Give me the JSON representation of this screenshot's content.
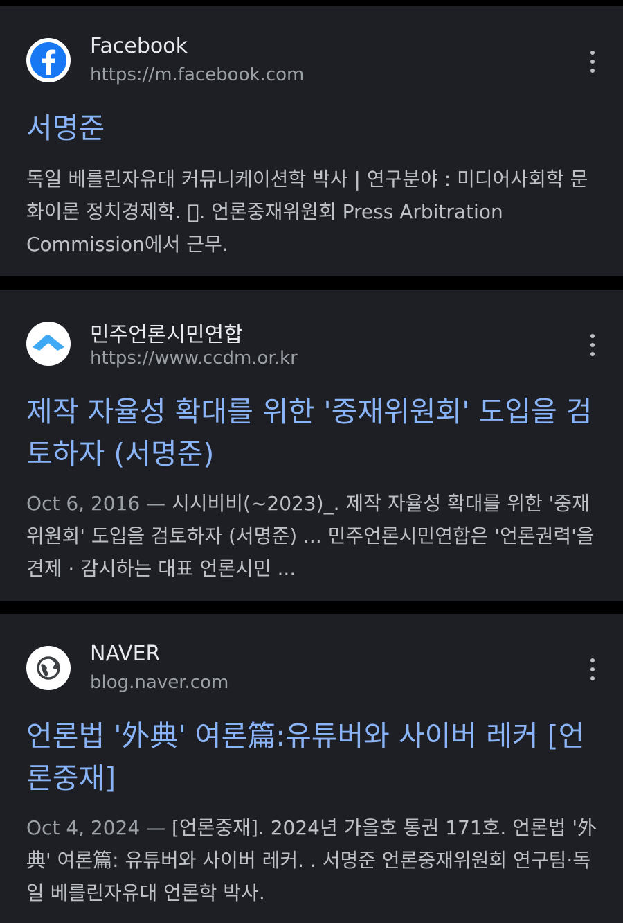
{
  "results": [
    {
      "site_name": "Facebook",
      "url": "https://m.facebook.com",
      "favicon": "facebook-icon",
      "title": "서명준",
      "date": "",
      "snippet": "독일 베를린자유대 커뮤니케이션학 박사 | 연구분야 : 미디어사회학 문화이론 정치경제학. 󰟠. 언론중재위원회 Press Arbitration Commission에서 근무."
    },
    {
      "site_name": "민주언론시민연합",
      "url": "https://www.ccdm.or.kr",
      "favicon": "ccdm-logo-icon",
      "title": "제작 자율성 확대를 위한 '중재위원회' 도입을 검토하자 (서명준)",
      "date": "Oct 6, 2016",
      "snippet": "시시비비(~2023)_. 제작 자율성 확대를 위한 '중재위원회' 도입을 검토하자 (서명준) ... 민주언론시민연합은 '언론권력'을 견제 · 감시하는 대표 언론시민 ..."
    },
    {
      "site_name": "NAVER",
      "url": "blog.naver.com",
      "favicon": "globe-icon",
      "title": "언론법 '外典' 여론篇:유튜버와 사이버 레커 [언론중재]",
      "date": "Oct 4, 2024",
      "snippet": "[언론중재]. 2024년 가을호 통권 171호. 언론법 '外典' 여론篇: 유튜버와 사이버 레커. . 서명준 언론중재위원회 연구팀·독일 베를린자유대 언론학 박사."
    }
  ],
  "date_separator": " — ",
  "colors": {
    "background": "#000000",
    "card": "#1e1f24",
    "title_link": "#8ab4f8",
    "snippet_text": "#bdc1c6",
    "secondary_text": "#9aa0a6",
    "facebook_blue": "#1877f2",
    "ccdm_blue": "#3fa9f5"
  }
}
